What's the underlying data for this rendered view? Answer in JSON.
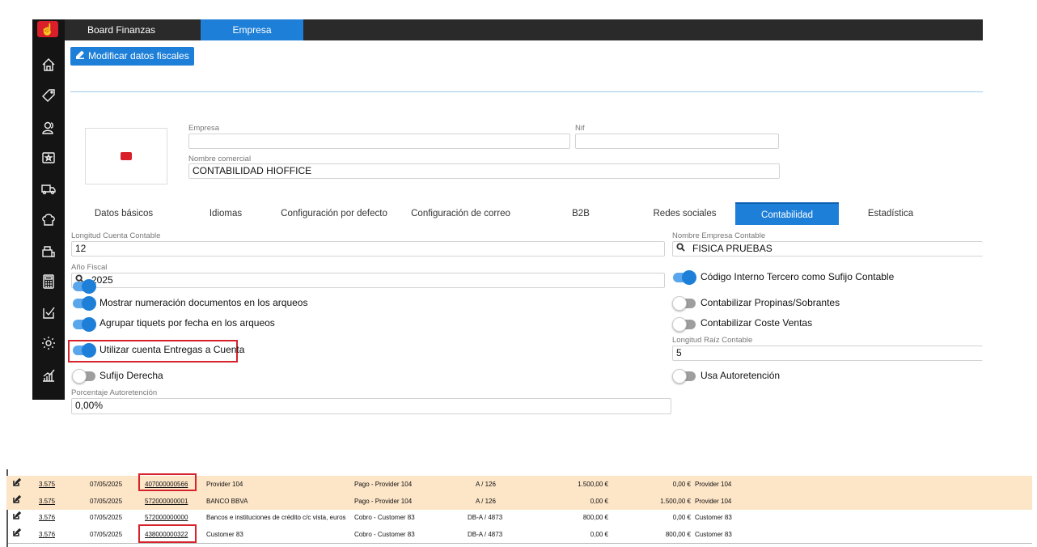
{
  "topbar": {
    "tabs": [
      {
        "label": "Board Finanzas",
        "active": false
      },
      {
        "label": "Empresa",
        "active": true
      }
    ]
  },
  "sidebar": {
    "icons": [
      "home-icon",
      "tag-icon",
      "users-icon",
      "star-card-icon",
      "truck-icon",
      "chef-hat-icon",
      "cash-register-icon",
      "calculator-icon",
      "checklist-icon",
      "gear-icon",
      "chart-icon"
    ]
  },
  "toolbar": {
    "edit_label": "Modificar datos fiscales"
  },
  "company": {
    "empresa_label": "Empresa",
    "empresa_value": "",
    "nif_label": "Nif",
    "nif_value": "",
    "nombre_label": "Nombre comercial",
    "nombre_value": "CONTABILIDAD HIOFFICE"
  },
  "tabs": [
    {
      "label": "Datos básicos",
      "active": false
    },
    {
      "label": "Idiomas",
      "active": false
    },
    {
      "label": "Configuración por defecto",
      "active": false
    },
    {
      "label": "Configuración de correo",
      "active": false
    },
    {
      "label": "B2B",
      "active": false
    },
    {
      "label": "Redes sociales",
      "active": false
    },
    {
      "label": "Contabilidad",
      "active": true
    },
    {
      "label": "Estadística",
      "active": false
    }
  ],
  "accounting": {
    "longitud_label": "Longitud Cuenta Contable",
    "longitud_value": "12",
    "anio_label": "Año Fiscal",
    "anio_value": "2025",
    "nombre_empresa_label": "Nombre Empresa Contable",
    "nombre_empresa_value": "FISICA PRUEBAS",
    "codigo_interno_label": "Código Interno Tercero como Sufijo Contable",
    "codigo_interno_on": true,
    "mostrar_label": "Mostrar numeración documentos en los arqueos",
    "mostrar_on": true,
    "propinas_label": "Contabilizar Propinas/Sobrantes",
    "propinas_on": false,
    "agrupar_label": "Agrupar tiquets por fecha en los arqueos",
    "agrupar_on": true,
    "coste_label": "Contabilizar Coste Ventas",
    "coste_on": false,
    "utilizar_label": "Utilizar cuenta Entregas a Cuenta",
    "utilizar_on": true,
    "raiz_label": "Longitud Raíz Contable",
    "raiz_value": "5",
    "sufijo_label": "Sufijo Derecha",
    "sufijo_on": false,
    "autoretencion_label": "Usa Autoretención",
    "autoretencion_on": false,
    "porcentaje_label": "Porcentaje Autoretención",
    "porcentaje_value": "0,00%"
  },
  "ledger": {
    "rows": [
      {
        "asiento": "3.575",
        "fecha": "07/05/2025",
        "cuenta": "407000000566",
        "nombre": "Provider 104",
        "concepto": "Pago - Provider 104",
        "doc": "A / 126",
        "debe": "1.500,00 €",
        "haber": "0,00 €",
        "tercero": "Provider 104",
        "highlight": true,
        "boxed": true
      },
      {
        "asiento": "3.575",
        "fecha": "07/05/2025",
        "cuenta": "572000000001",
        "nombre": "BANCO BBVA",
        "concepto": "Pago - Provider 104",
        "doc": "A / 126",
        "debe": "0,00 €",
        "haber": "1.500,00 €",
        "tercero": "Provider 104",
        "highlight": true,
        "boxed": false
      },
      {
        "asiento": "3.576",
        "fecha": "07/05/2025",
        "cuenta": "572000000000",
        "nombre": "Bancos e instituciones de crédito c/c vista, euros",
        "concepto": "Cobro - Customer 83",
        "doc": "DB-A / 4873",
        "debe": "800,00 €",
        "haber": "0,00 €",
        "tercero": "Customer 83",
        "highlight": false,
        "boxed": false
      },
      {
        "asiento": "3.576",
        "fecha": "07/05/2025",
        "cuenta": "438000000322",
        "nombre": "Customer 83",
        "concepto": "Cobro - Customer 83",
        "doc": "DB-A / 4873",
        "debe": "0,00 €",
        "haber": "800,00 €",
        "tercero": "Customer 83",
        "highlight": false,
        "boxed": true
      }
    ]
  },
  "colors": {
    "accent": "#1e7fd8",
    "sidebar": "#141414",
    "highlight_row": "#fde5c8",
    "callout": "#d6232b"
  }
}
